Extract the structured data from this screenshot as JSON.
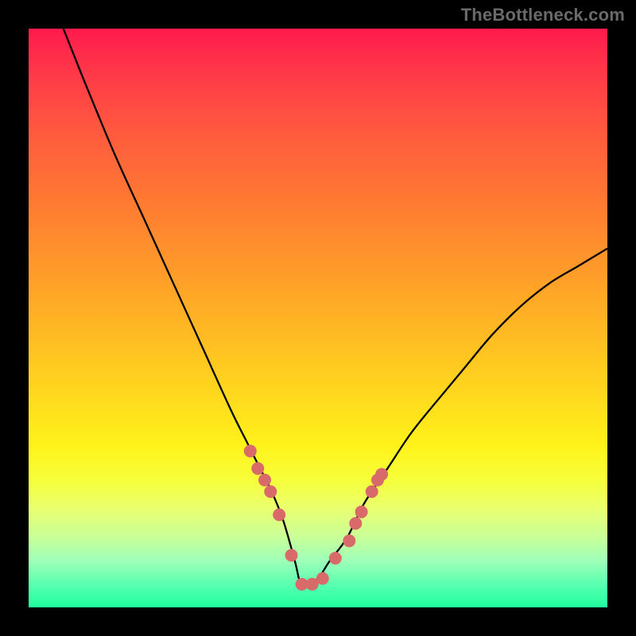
{
  "watermark": {
    "text": "TheBottleneck.com"
  },
  "colors": {
    "frame": "#000000",
    "curve": "#000000",
    "dots": "#d96a6a",
    "gradient_top": "#ff1a4d",
    "gradient_bottom": "#1eff9e"
  },
  "chart_data": {
    "type": "line",
    "title": "",
    "xlabel": "",
    "ylabel": "",
    "xlim": [
      0,
      100
    ],
    "ylim": [
      0,
      100
    ],
    "grid": false,
    "legend": false,
    "description": "V-shaped bottleneck curve on a vertical red-to-green gradient. Minimum (optimal match) near x≈47. Pink dots mark sampled points on the lower part of both branches.",
    "series": [
      {
        "name": "bottleneck-curve",
        "x": [
          6,
          10,
          15,
          20,
          25,
          30,
          35,
          38,
          40,
          42,
          44,
          46,
          47,
          48,
          50,
          52,
          55,
          58,
          62,
          66,
          70,
          75,
          80,
          85,
          90,
          95,
          100
        ],
        "y": [
          100,
          90,
          78,
          67,
          56,
          45,
          34,
          28,
          24,
          20,
          15,
          8,
          4,
          4,
          5,
          8,
          12,
          18,
          24,
          30,
          35,
          41,
          47,
          52,
          56,
          59,
          62
        ]
      }
    ],
    "dots": {
      "name": "sample-points",
      "x": [
        38.3,
        39.6,
        40.8,
        41.8,
        43.3,
        45.4,
        47.2,
        49.0,
        50.8,
        53.0,
        55.4,
        56.5,
        57.5,
        59.3,
        60.3,
        61.0
      ],
      "y": [
        27.0,
        24.0,
        22.0,
        20.0,
        16.0,
        9.0,
        4.0,
        4.0,
        5.0,
        8.5,
        11.5,
        14.5,
        16.5,
        20.0,
        22.0,
        23.0
      ]
    }
  }
}
